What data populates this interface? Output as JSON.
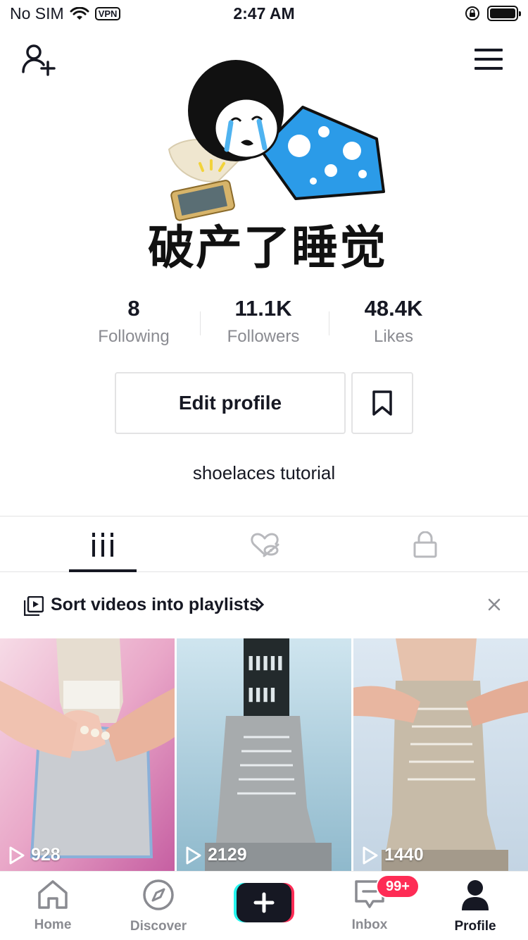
{
  "status_bar": {
    "carrier": "No SIM",
    "vpn_label": "VPN",
    "time": "2:47 AM"
  },
  "profile": {
    "avatar_caption": "破产了睡觉",
    "bio": "shoelaces tutorial",
    "edit_profile_label": "Edit profile"
  },
  "stats": [
    {
      "value": "8",
      "label": "Following"
    },
    {
      "value": "11.1K",
      "label": "Followers"
    },
    {
      "value": "48.4K",
      "label": "Likes"
    }
  ],
  "tabs": [
    {
      "icon": "grid-bars-icon",
      "active": true
    },
    {
      "icon": "hidden-like-icon",
      "active": false
    },
    {
      "icon": "lock-icon",
      "active": false
    }
  ],
  "playlist_prompt": {
    "text": "Sort videos into playlists"
  },
  "videos": [
    {
      "views": "928"
    },
    {
      "views": "2129"
    },
    {
      "views": "1440"
    }
  ],
  "bottom_nav": {
    "home": "Home",
    "discover": "Discover",
    "inbox": "Inbox",
    "inbox_badge": "99+",
    "profile": "Profile"
  },
  "colors": {
    "accent_red": "#fe2c55",
    "accent_cyan": "#25f4ee",
    "text_primary": "#161823",
    "text_secondary": "#8a8b91"
  }
}
